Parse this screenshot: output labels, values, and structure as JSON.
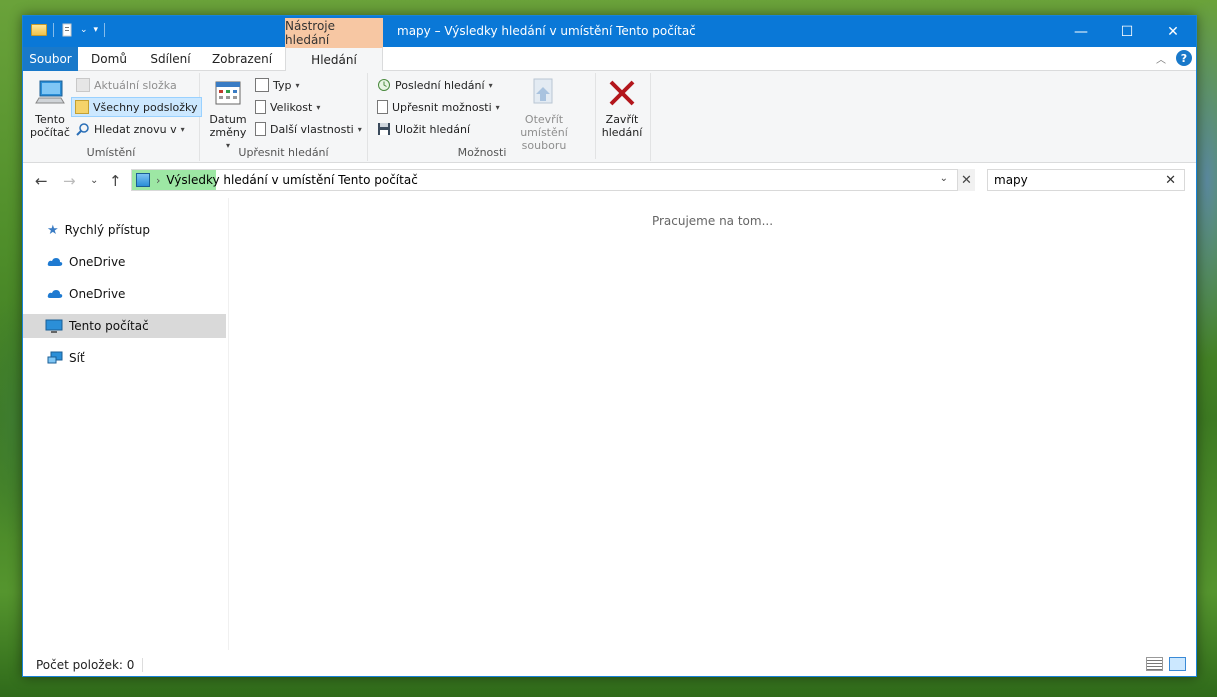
{
  "window": {
    "title": "mapy – Výsledky hledání v umístění Tento počítač",
    "contextual_tab": "Nástroje hledání",
    "controls": {
      "minimize": "—",
      "maximize": "☐",
      "close": "✕"
    }
  },
  "tabs": {
    "file": "Soubor",
    "home": "Domů",
    "share": "Sdílení",
    "view": "Zobrazení",
    "search": "Hledání"
  },
  "ribbon": {
    "location": {
      "label": "Umístění",
      "this_pc": "Tento počítač",
      "current_folder": "Aktuální složka",
      "all_subfolders": "Všechny podsložky",
      "search_again": "Hledat znovu v"
    },
    "refine": {
      "label": "Upřesnit hledání",
      "date_modified": "Datum změny",
      "type": "Typ",
      "size": "Velikost",
      "other_properties": "Další vlastnosti"
    },
    "options": {
      "label": "Možnosti",
      "recent_searches": "Poslední hledání",
      "advanced_options": "Upřesnit možnosti",
      "save_search": "Uložit hledání",
      "open_file_location": "Otevřít umístění souboru",
      "close_search": "Zavřít hledání"
    }
  },
  "address": {
    "path": "Výsledky hledání v umístění Tento počítač",
    "progress": 0.1
  },
  "search": {
    "value": "mapy"
  },
  "navpane": {
    "items": [
      {
        "label": "Rychlý přístup"
      },
      {
        "label": "OneDrive"
      },
      {
        "label": "OneDrive"
      },
      {
        "label": "Tento počítač"
      },
      {
        "label": "Síť"
      }
    ]
  },
  "main": {
    "status_message": "Pracujeme na tom..."
  },
  "statusbar": {
    "item_count": "Počet položek: 0"
  },
  "colors": {
    "titlebar": "#0a78d7",
    "file_tab": "#1979ca",
    "contextual": "#f7c7a3",
    "selection": "#cce8ff",
    "progress": "#9de7a4"
  }
}
